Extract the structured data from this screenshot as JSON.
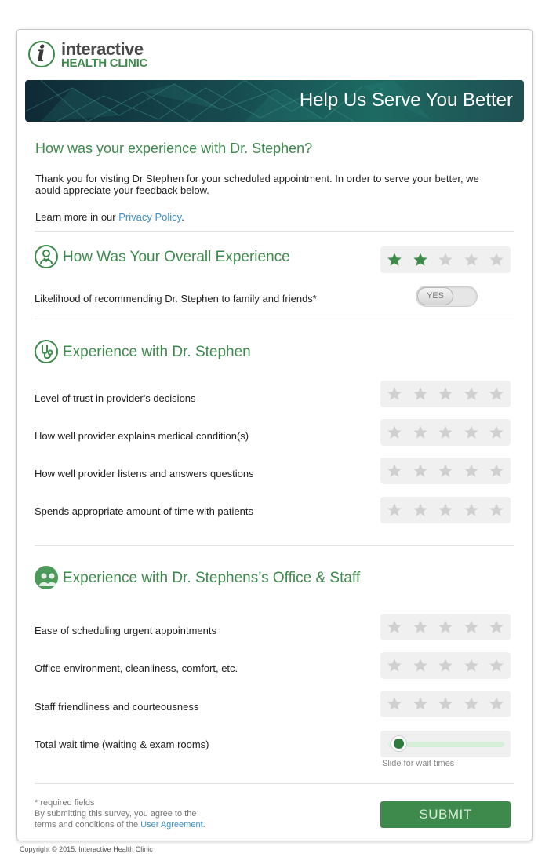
{
  "logo": {
    "line1": "interactive",
    "line2": "HEALTH CLINIC",
    "mark": "i"
  },
  "banner": {
    "title": "Help Us Serve You Better"
  },
  "intro": {
    "heading": "How was your experience with Dr. Stephen?",
    "body": "Thank you for visting Dr Stephen for your scheduled appointment. In order to serve your better, we aould appreciate your feedback below.",
    "privacy_prefix": "Learn more in our ",
    "privacy_link": "Privacy Policy",
    "privacy_suffix": "."
  },
  "sections": {
    "overall": {
      "icon": "doctor-icon",
      "title": "How Was Your Overall Experience",
      "rating": 2,
      "recommend_label": "Likelihood of recommending Dr. Stephen to family and friends*",
      "toggle_label": "YES"
    },
    "doctor": {
      "icon": "stethoscope-icon",
      "title": "Experience with Dr. Stephen",
      "rows": [
        {
          "label": "Level of trust in provider's decisions",
          "rating": 0
        },
        {
          "label": "How well provider explains medical condition(s)",
          "rating": 0
        },
        {
          "label": "How well provider listens and answers questions",
          "rating": 0
        },
        {
          "label": "Spends appropriate amount of time with patients",
          "rating": 0
        }
      ]
    },
    "office": {
      "icon": "staff-group-icon",
      "title": "Experience with Dr. Stephens’s Office & Staff",
      "rows": [
        {
          "label": "Ease of scheduling urgent appointments",
          "rating": 0
        },
        {
          "label": "Office environment, cleanliness, comfort, etc.",
          "rating": 0
        },
        {
          "label": "Staff friendliness and courteousness",
          "rating": 0
        }
      ],
      "wait_label": "Total wait time (waiting & exam rooms)",
      "wait_value": 0,
      "slider_caption": "Slide for wait times"
    }
  },
  "footer": {
    "required": "* required fields",
    "agree_line1": "By submitting this survey, you agree to the",
    "agree_prefix": "terms and conditions of the ",
    "agreement_link": "User Agreement",
    "agree_suffix": ".",
    "submit_label": "SUBMIT"
  },
  "copyright": "Copyright © 2015. Interactive Health Clinic",
  "colors": {
    "brand_green": "#3e8a4c",
    "star_active": "#3e8a4c",
    "star_inactive": "#d0d0d0",
    "link": "#3b8fc4"
  }
}
